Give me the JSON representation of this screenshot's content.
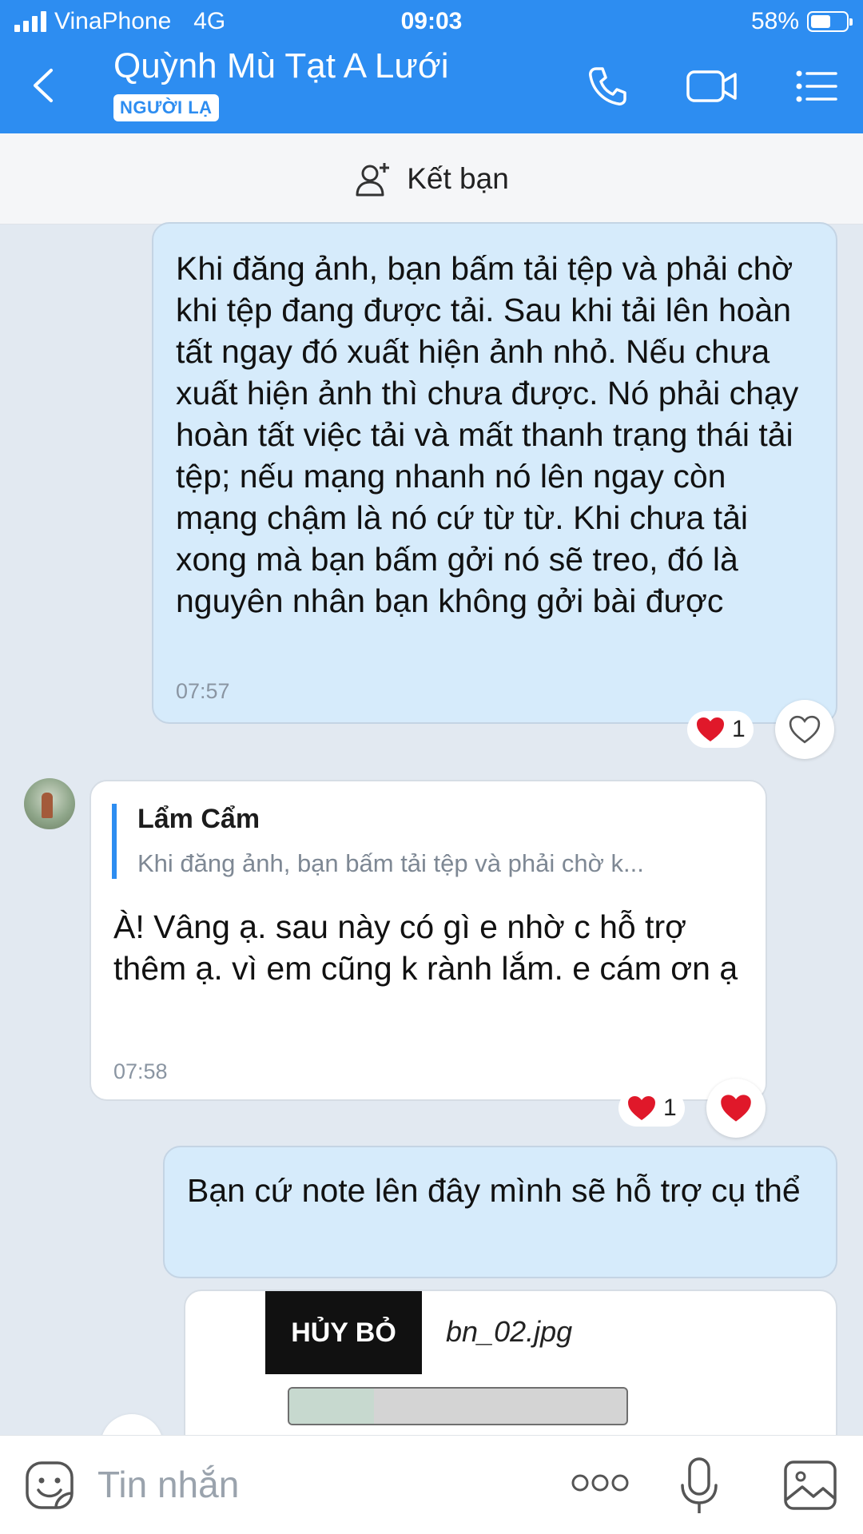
{
  "status": {
    "carrier": "VinaPhone",
    "network": "4G",
    "time": "09:03",
    "battery": "58%"
  },
  "header": {
    "name": "Quỳnh Mù Tạt A Lưới",
    "badge": "NGƯỜI LẠ"
  },
  "add_friend": {
    "label": "Kết bạn"
  },
  "messages": [
    {
      "direction": "out",
      "text": "Khi đăng ảnh, bạn bấm tải tệp và phải chờ khi tệp đang được tải. Sau khi tải lên hoàn tất ngay đó xuất hiện ảnh nhỏ. Nếu chưa xuất hiện ảnh thì chưa được. Nó phải chạy hoàn tất việc tải và mất thanh trạng thái tải tệp; nếu mạng nhanh nó lên ngay còn mạng chậm là nó cứ từ từ. Khi chưa tải xong mà bạn bấm gởi nó sẽ treo, đó là nguyên nhân bạn không gởi bài được",
      "time": "07:57",
      "reaction_count": "1"
    },
    {
      "direction": "in",
      "quote_author": "Lẩm Cẩm",
      "quote_text": "Khi đăng ảnh, bạn bấm tải tệp và phải chờ k...",
      "text": "À! Vâng ạ. sau này có gì e nhờ c hỗ trợ thêm ạ. vì em cũng k rành lắm. e cám ơn ạ",
      "time": "07:58",
      "reaction_count": "1"
    },
    {
      "direction": "out",
      "text": "Bạn cứ note lên đây mình sẽ hỗ trợ cụ thể"
    }
  ],
  "upload": {
    "cancel_label": "HỦY BỎ",
    "file_name": "bn_02.jpg",
    "progress": 0.25
  },
  "composer": {
    "placeholder": "Tin nhắn"
  },
  "colors": {
    "header": "#2d8df1",
    "outgoing": "#d6ebfb",
    "heart": "#e0182a"
  }
}
